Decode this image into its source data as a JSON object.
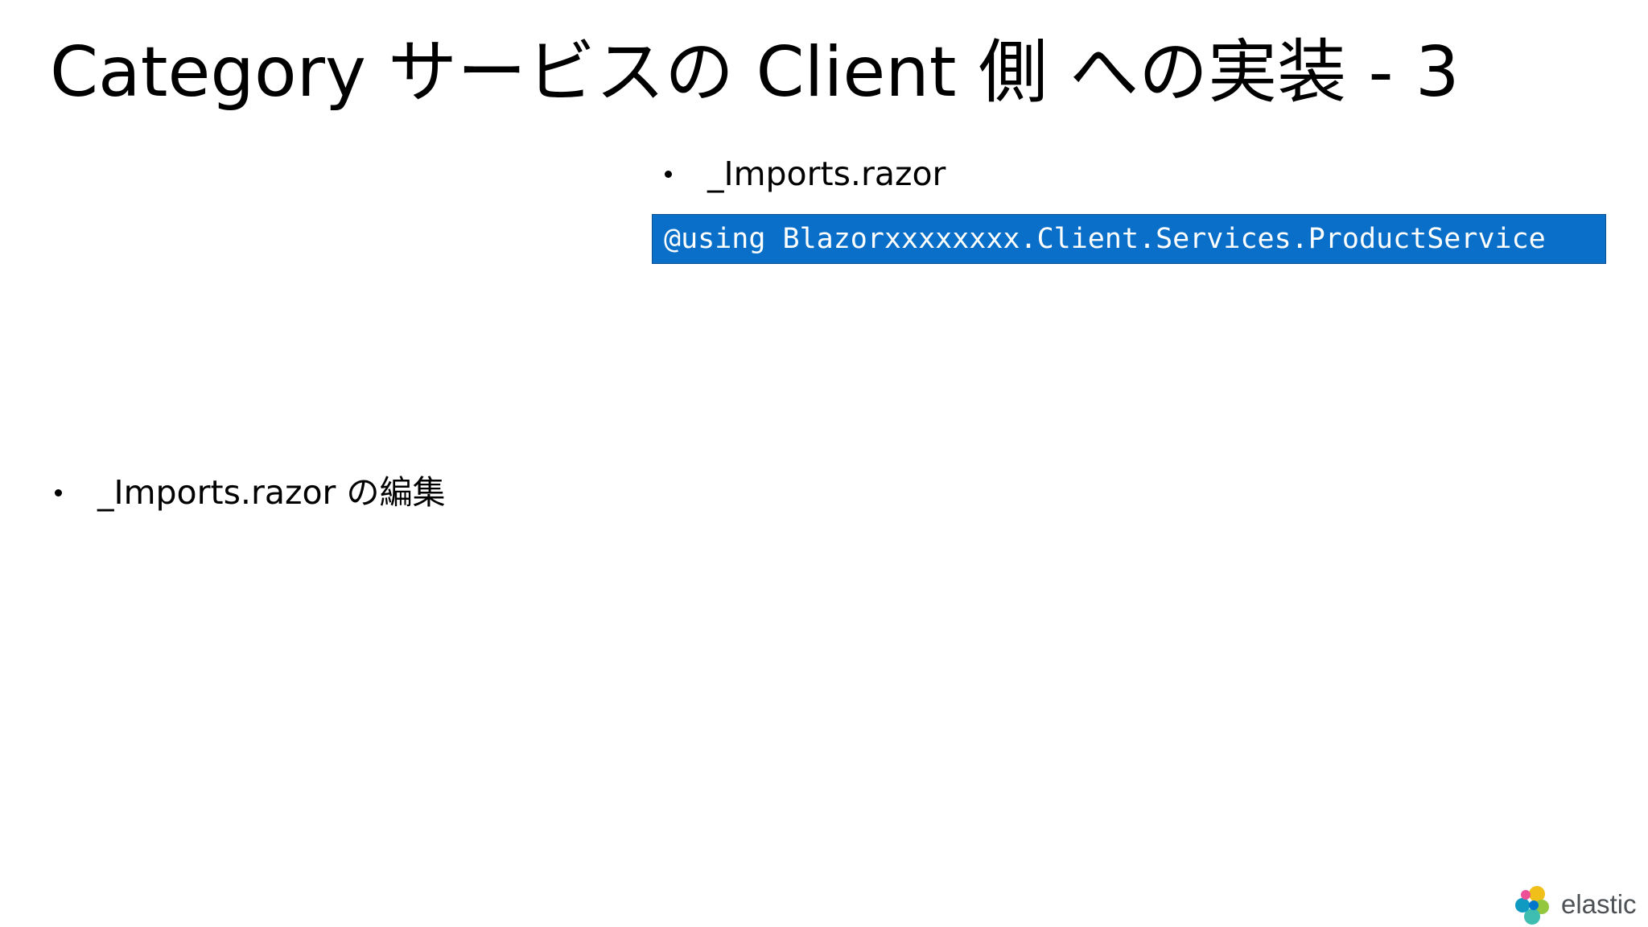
{
  "slide": {
    "title": "Category サービスの Client 側 への実装 - 3",
    "bullets_left": [
      {
        "text": "_Imports.razor の編集"
      }
    ],
    "bullets_right": [
      {
        "text": "_Imports.razor"
      }
    ],
    "code": {
      "line": "@using Blazorxxxxxxxx.Client.Services.ProductService",
      "background": "#0a6fc9",
      "text_color": "#ffffff"
    }
  },
  "logo": {
    "text": "elastic",
    "icon": "elastic-logo-icon",
    "colors": [
      "#f0bf1a",
      "#3ebeb0",
      "#07c",
      "#ee5097",
      "#93c83e",
      "#0f9ac2"
    ]
  }
}
